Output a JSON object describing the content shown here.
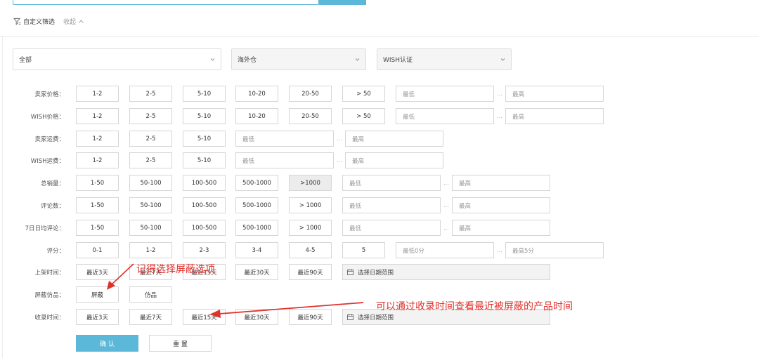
{
  "header": {
    "filter_title": "自定义筛选",
    "collapse_label": "收起"
  },
  "selects": [
    {
      "value": "全部"
    },
    {
      "value": "海外仓"
    },
    {
      "value": "WISH认证"
    }
  ],
  "rows": [
    {
      "label": "卖家价格：",
      "options": [
        "1-2",
        "2-5",
        "5-10",
        "10-20",
        "20-50",
        "> 50"
      ],
      "min": "最低",
      "max": "最高"
    },
    {
      "label": "WISH价格：",
      "options": [
        "1-2",
        "2-5",
        "5-10",
        "10-20",
        "20-50",
        "> 50"
      ],
      "min": "最低",
      "max": "最高"
    },
    {
      "label": "卖家运费：",
      "options": [
        "1-2",
        "2-5",
        "5-10"
      ],
      "min": "最低",
      "max": "最高"
    },
    {
      "label": "WISH运费：",
      "options": [
        "1-2",
        "2-5",
        "5-10"
      ],
      "min": "最低",
      "max": "最高"
    },
    {
      "label": "总销量：",
      "options": [
        "1-50",
        "50-100",
        "100-500",
        "500-1000",
        ">1000"
      ],
      "min": "最低",
      "max": "最高"
    },
    {
      "label": "评论数：",
      "options": [
        "1-50",
        "50-100",
        "100-500",
        "500-1000",
        "> 1000"
      ],
      "min": "最低",
      "max": "最高"
    },
    {
      "label": "7日日均评论：",
      "options": [
        "1-50",
        "50-100",
        "100-500",
        "500-1000",
        "> 1000"
      ],
      "min": "最低",
      "max": "最高"
    },
    {
      "label": "评分：",
      "options": [
        "0-1",
        "1-2",
        "2-3",
        "3-4",
        "4-5",
        "5"
      ],
      "min": "最低0分",
      "max": "最高5分"
    },
    {
      "label": "上架时间：",
      "options": [
        "最近3天",
        "最近7天",
        "最近15天",
        "最近30天",
        "最近90天"
      ],
      "date_placeholder": "选择日期范围"
    },
    {
      "label": "屏蔽仿品：",
      "options": [
        "屏蔽",
        "仿品"
      ]
    },
    {
      "label": "收录时间：",
      "options": [
        "最近3天",
        "最近7天",
        "最近15天",
        "最近30天",
        "最近90天"
      ],
      "date_placeholder": "选择日期范围"
    }
  ],
  "actions": {
    "confirm": "确 认",
    "reset": "重 置"
  },
  "annotations": {
    "note1": "记得选择屏蔽选项",
    "note2": "可以通过收录时间查看最近被屏蔽的产品时间",
    "color": "#e0322c"
  },
  "colors": {
    "accent": "#5bb8d8",
    "selected_bg": "#ececec"
  },
  "icons": {
    "filter": "filter-icon",
    "collapse": "chevron-up-icon",
    "select": "chevron-down-icon",
    "date": "calendar-icon"
  }
}
